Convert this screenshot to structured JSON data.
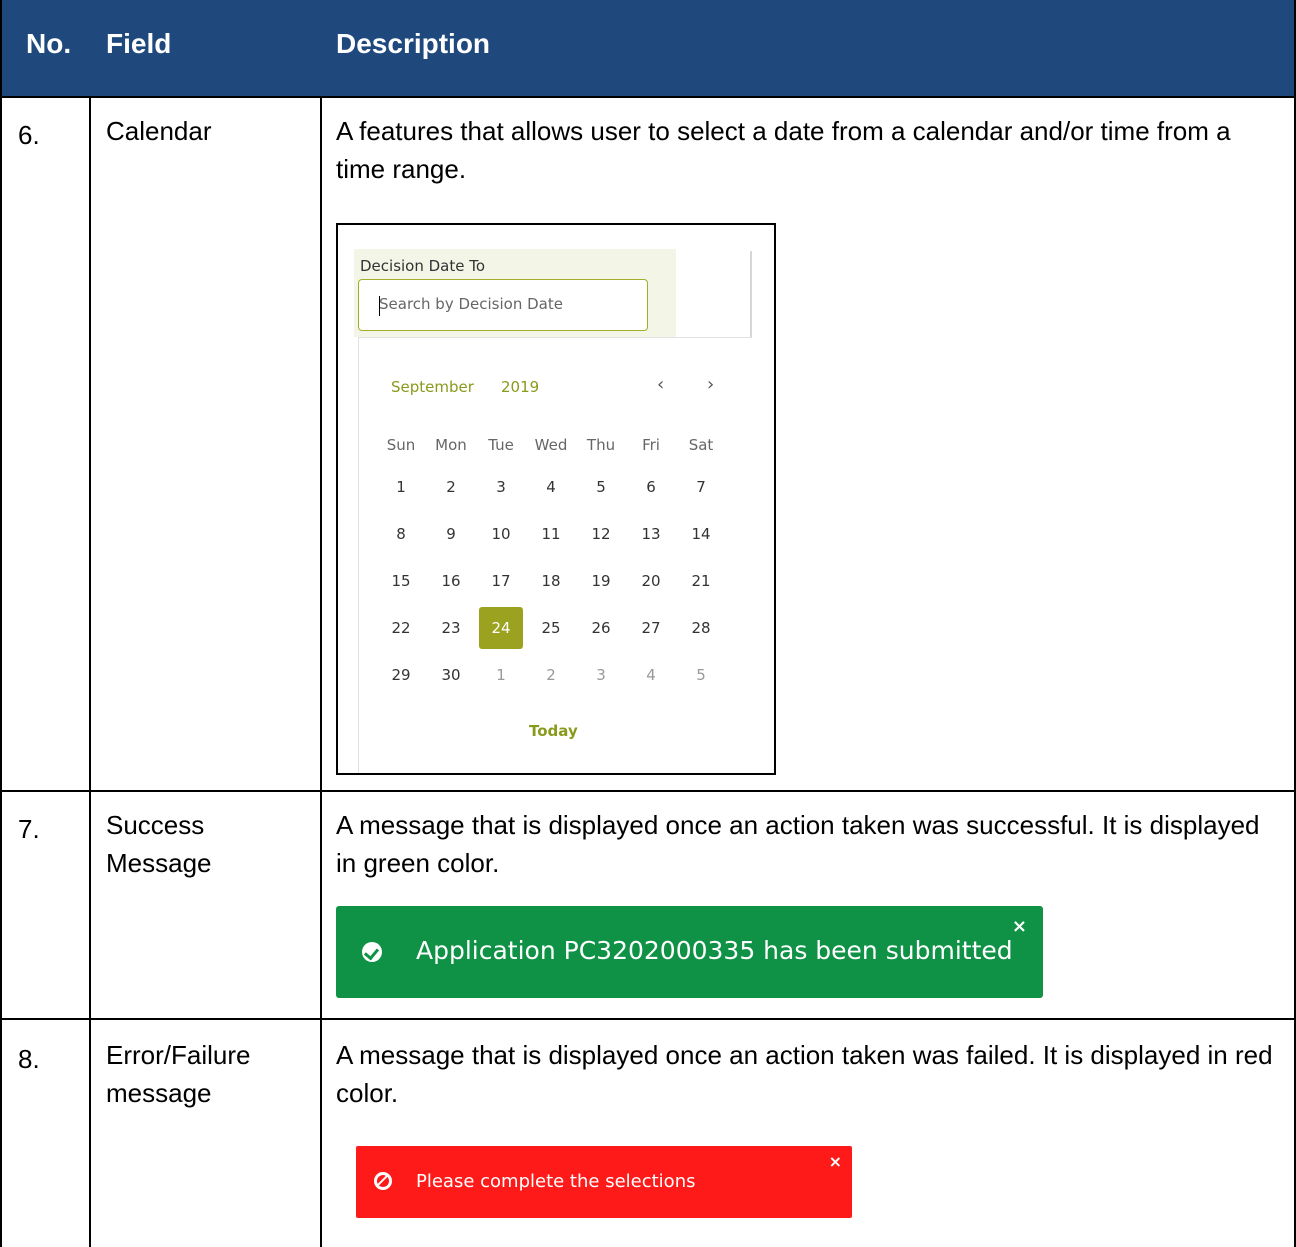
{
  "table": {
    "headers": {
      "no": "No.",
      "field": "Field",
      "description": "Description"
    },
    "rows": [
      {
        "no": "6.",
        "field": "Calendar",
        "description": "A features that allows user to select a date from a calendar and/or time from a time range."
      },
      {
        "no": "7.",
        "field_lines": [
          "Success",
          "Message"
        ],
        "description": "A message that is displayed once an action taken was successful. It is displayed in green color."
      },
      {
        "no": "8.",
        "field_lines": [
          "Error/Failure",
          "message"
        ],
        "description": "A message that is displayed once an action taken was failed. It is displayed in red color."
      }
    ]
  },
  "calendar": {
    "label": "Decision Date To",
    "placeholder": "Search by Decision Date",
    "month": "September",
    "year": "2019",
    "prev": "‹",
    "next": "›",
    "weekdays": [
      "Sun",
      "Mon",
      "Tue",
      "Wed",
      "Thu",
      "Fri",
      "Sat"
    ],
    "weeks": [
      [
        "1",
        "2",
        "3",
        "4",
        "5",
        "6",
        "7"
      ],
      [
        "8",
        "9",
        "10",
        "11",
        "12",
        "13",
        "14"
      ],
      [
        "15",
        "16",
        "17",
        "18",
        "19",
        "20",
        "21"
      ],
      [
        "22",
        "23",
        "24",
        "25",
        "26",
        "27",
        "28"
      ],
      [
        "29",
        "30",
        "1",
        "2",
        "3",
        "4",
        "5"
      ]
    ],
    "selected": "24",
    "today_label": "Today",
    "accent_color": "#9aa21f"
  },
  "success_message": {
    "text": "Application PC3202000335 has been submitted",
    "close": "×",
    "color": "#0f9246",
    "icon": "check-circle-icon"
  },
  "error_message": {
    "text": "Please complete the selections",
    "close": "×",
    "color": "#ff1a1a",
    "icon": "ban-icon"
  },
  "header_color": "#1f497d"
}
